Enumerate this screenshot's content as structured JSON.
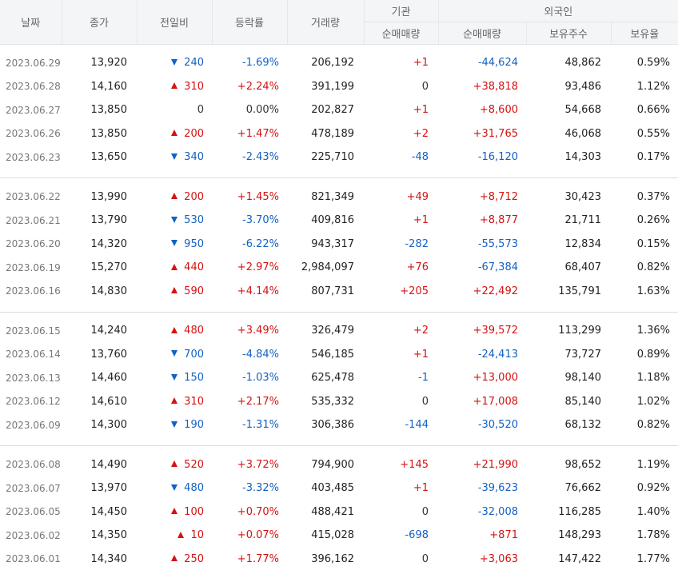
{
  "headers": {
    "date": "날짜",
    "close": "종가",
    "change": "전일비",
    "rate": "등락률",
    "volume": "거래량",
    "institution": "기관",
    "inst_net": "순매매량",
    "foreign": "외국인",
    "foreign_net": "순매매량",
    "foreign_hold": "보유주수",
    "foreign_ratio": "보유율"
  },
  "colors": {
    "up": "#d51212",
    "down": "#1261c4",
    "header_bg": "#f4f5f7"
  },
  "groups": [
    [
      {
        "date": "2023.06.29",
        "close": "13,920",
        "dir": "down",
        "change": "240",
        "rate": "-1.69%",
        "volume": "206,192",
        "inst": "+1",
        "fnet": "-44,624",
        "fhold": "48,862",
        "fratio": "0.59%"
      },
      {
        "date": "2023.06.28",
        "close": "14,160",
        "dir": "up",
        "change": "310",
        "rate": "+2.24%",
        "volume": "391,199",
        "inst": "0",
        "fnet": "+38,818",
        "fhold": "93,486",
        "fratio": "1.12%"
      },
      {
        "date": "2023.06.27",
        "close": "13,850",
        "dir": "flat",
        "change": "0",
        "rate": "0.00%",
        "volume": "202,827",
        "inst": "+1",
        "fnet": "+8,600",
        "fhold": "54,668",
        "fratio": "0.66%"
      },
      {
        "date": "2023.06.26",
        "close": "13,850",
        "dir": "up",
        "change": "200",
        "rate": "+1.47%",
        "volume": "478,189",
        "inst": "+2",
        "fnet": "+31,765",
        "fhold": "46,068",
        "fratio": "0.55%"
      },
      {
        "date": "2023.06.23",
        "close": "13,650",
        "dir": "down",
        "change": "340",
        "rate": "-2.43%",
        "volume": "225,710",
        "inst": "-48",
        "fnet": "-16,120",
        "fhold": "14,303",
        "fratio": "0.17%"
      }
    ],
    [
      {
        "date": "2023.06.22",
        "close": "13,990",
        "dir": "up",
        "change": "200",
        "rate": "+1.45%",
        "volume": "821,349",
        "inst": "+49",
        "fnet": "+8,712",
        "fhold": "30,423",
        "fratio": "0.37%"
      },
      {
        "date": "2023.06.21",
        "close": "13,790",
        "dir": "down",
        "change": "530",
        "rate": "-3.70%",
        "volume": "409,816",
        "inst": "+1",
        "fnet": "+8,877",
        "fhold": "21,711",
        "fratio": "0.26%"
      },
      {
        "date": "2023.06.20",
        "close": "14,320",
        "dir": "down",
        "change": "950",
        "rate": "-6.22%",
        "volume": "943,317",
        "inst": "-282",
        "fnet": "-55,573",
        "fhold": "12,834",
        "fratio": "0.15%"
      },
      {
        "date": "2023.06.19",
        "close": "15,270",
        "dir": "up",
        "change": "440",
        "rate": "+2.97%",
        "volume": "2,984,097",
        "inst": "+76",
        "fnet": "-67,384",
        "fhold": "68,407",
        "fratio": "0.82%"
      },
      {
        "date": "2023.06.16",
        "close": "14,830",
        "dir": "up",
        "change": "590",
        "rate": "+4.14%",
        "volume": "807,731",
        "inst": "+205",
        "fnet": "+22,492",
        "fhold": "135,791",
        "fratio": "1.63%"
      }
    ],
    [
      {
        "date": "2023.06.15",
        "close": "14,240",
        "dir": "up",
        "change": "480",
        "rate": "+3.49%",
        "volume": "326,479",
        "inst": "+2",
        "fnet": "+39,572",
        "fhold": "113,299",
        "fratio": "1.36%"
      },
      {
        "date": "2023.06.14",
        "close": "13,760",
        "dir": "down",
        "change": "700",
        "rate": "-4.84%",
        "volume": "546,185",
        "inst": "+1",
        "fnet": "-24,413",
        "fhold": "73,727",
        "fratio": "0.89%"
      },
      {
        "date": "2023.06.13",
        "close": "14,460",
        "dir": "down",
        "change": "150",
        "rate": "-1.03%",
        "volume": "625,478",
        "inst": "-1",
        "fnet": "+13,000",
        "fhold": "98,140",
        "fratio": "1.18%"
      },
      {
        "date": "2023.06.12",
        "close": "14,610",
        "dir": "up",
        "change": "310",
        "rate": "+2.17%",
        "volume": "535,332",
        "inst": "0",
        "fnet": "+17,008",
        "fhold": "85,140",
        "fratio": "1.02%"
      },
      {
        "date": "2023.06.09",
        "close": "14,300",
        "dir": "down",
        "change": "190",
        "rate": "-1.31%",
        "volume": "306,386",
        "inst": "-144",
        "fnet": "-30,520",
        "fhold": "68,132",
        "fratio": "0.82%"
      }
    ],
    [
      {
        "date": "2023.06.08",
        "close": "14,490",
        "dir": "up",
        "change": "520",
        "rate": "+3.72%",
        "volume": "794,900",
        "inst": "+145",
        "fnet": "+21,990",
        "fhold": "98,652",
        "fratio": "1.19%"
      },
      {
        "date": "2023.06.07",
        "close": "13,970",
        "dir": "down",
        "change": "480",
        "rate": "-3.32%",
        "volume": "403,485",
        "inst": "+1",
        "fnet": "-39,623",
        "fhold": "76,662",
        "fratio": "0.92%"
      },
      {
        "date": "2023.06.05",
        "close": "14,450",
        "dir": "up",
        "change": "100",
        "rate": "+0.70%",
        "volume": "488,421",
        "inst": "0",
        "fnet": "-32,008",
        "fhold": "116,285",
        "fratio": "1.40%"
      },
      {
        "date": "2023.06.02",
        "close": "14,350",
        "dir": "up",
        "change": "10",
        "rate": "+0.07%",
        "volume": "415,028",
        "inst": "-698",
        "fnet": "+871",
        "fhold": "148,293",
        "fratio": "1.78%"
      },
      {
        "date": "2023.06.01",
        "close": "14,340",
        "dir": "up",
        "change": "250",
        "rate": "+1.77%",
        "volume": "396,162",
        "inst": "0",
        "fnet": "+3,063",
        "fhold": "147,422",
        "fratio": "1.77%"
      }
    ]
  ]
}
